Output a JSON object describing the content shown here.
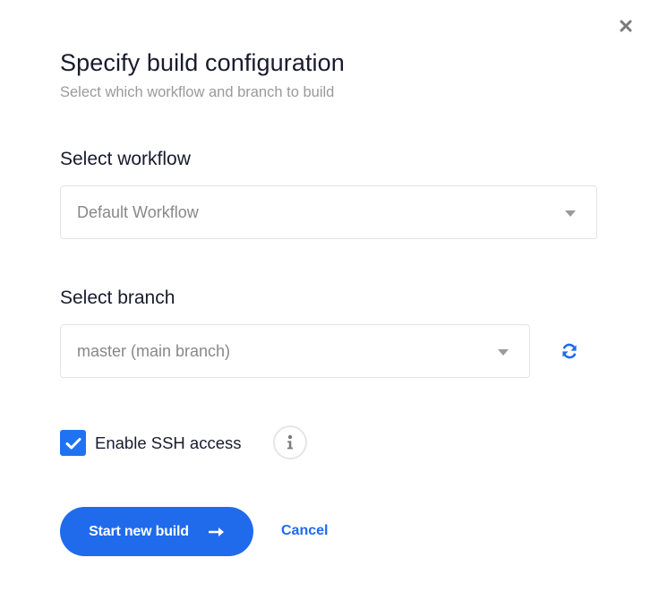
{
  "dialog": {
    "title": "Specify build configuration",
    "subtitle": "Select which workflow and branch to build",
    "close_icon": "close-icon"
  },
  "workflow": {
    "label": "Select workflow",
    "selected_value": "Default Workflow",
    "caret_icon": "chevron-down-icon"
  },
  "branch": {
    "label": "Select branch",
    "selected_value": "master (main branch)",
    "caret_icon": "chevron-down-icon",
    "refresh_icon": "refresh-icon"
  },
  "ssh": {
    "label": "Enable SSH access",
    "checked": true,
    "info_icon": "info-icon"
  },
  "actions": {
    "start_label": "Start new build",
    "start_icon": "arrow-right-icon",
    "cancel_label": "Cancel"
  },
  "colors": {
    "accent": "#1f6bec",
    "checkbox": "#1f73f1",
    "title_text": "#1a1a2e",
    "muted_text": "#9a9a9a",
    "border": "#e4e4e4"
  }
}
